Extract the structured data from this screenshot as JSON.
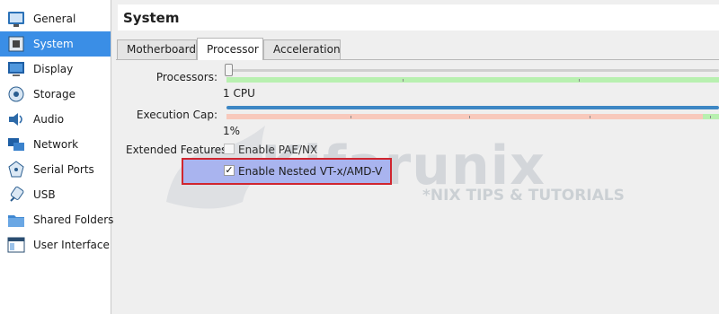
{
  "sidebar": {
    "items": [
      {
        "label": "General",
        "icon": "general-icon"
      },
      {
        "label": "System",
        "icon": "system-icon",
        "selected": true
      },
      {
        "label": "Display",
        "icon": "display-icon"
      },
      {
        "label": "Storage",
        "icon": "storage-icon"
      },
      {
        "label": "Audio",
        "icon": "audio-icon"
      },
      {
        "label": "Network",
        "icon": "network-icon"
      },
      {
        "label": "Serial Ports",
        "icon": "serial-ports-icon"
      },
      {
        "label": "USB",
        "icon": "usb-icon"
      },
      {
        "label": "Shared Folders",
        "icon": "shared-folders-icon"
      },
      {
        "label": "User Interface",
        "icon": "user-interface-icon"
      }
    ]
  },
  "header": {
    "title": "System"
  },
  "tabs": [
    {
      "label": "Motherboard",
      "active": false
    },
    {
      "label": "Processor",
      "active": true
    },
    {
      "label": "Acceleration",
      "active": false
    }
  ],
  "processor": {
    "processors_label": "Processors:",
    "processors_value": "1 CPU",
    "processors_fraction": 0.0,
    "exec_cap_label": "Execution Cap:",
    "exec_cap_value": "1%",
    "exec_cap_fraction": 1.0,
    "extended_features_label": "Extended Features:",
    "pae_label": "Enable PAE/NX",
    "pae_checked": false,
    "nested_label": "Enable Nested VT-x/AMD-V",
    "nested_checked": true
  },
  "watermark": {
    "logo_text": "Kifarunix",
    "tagline": "*NIX TIPS & TUTORIALS"
  },
  "colors": {
    "selection": "#3a8ee6",
    "highlight_fill": "#a9b4ef",
    "highlight_border": "#d0262f",
    "slider_fill": "#3d87c4",
    "band_green": "#b8f0b0",
    "band_red": "#f8c9bc"
  }
}
